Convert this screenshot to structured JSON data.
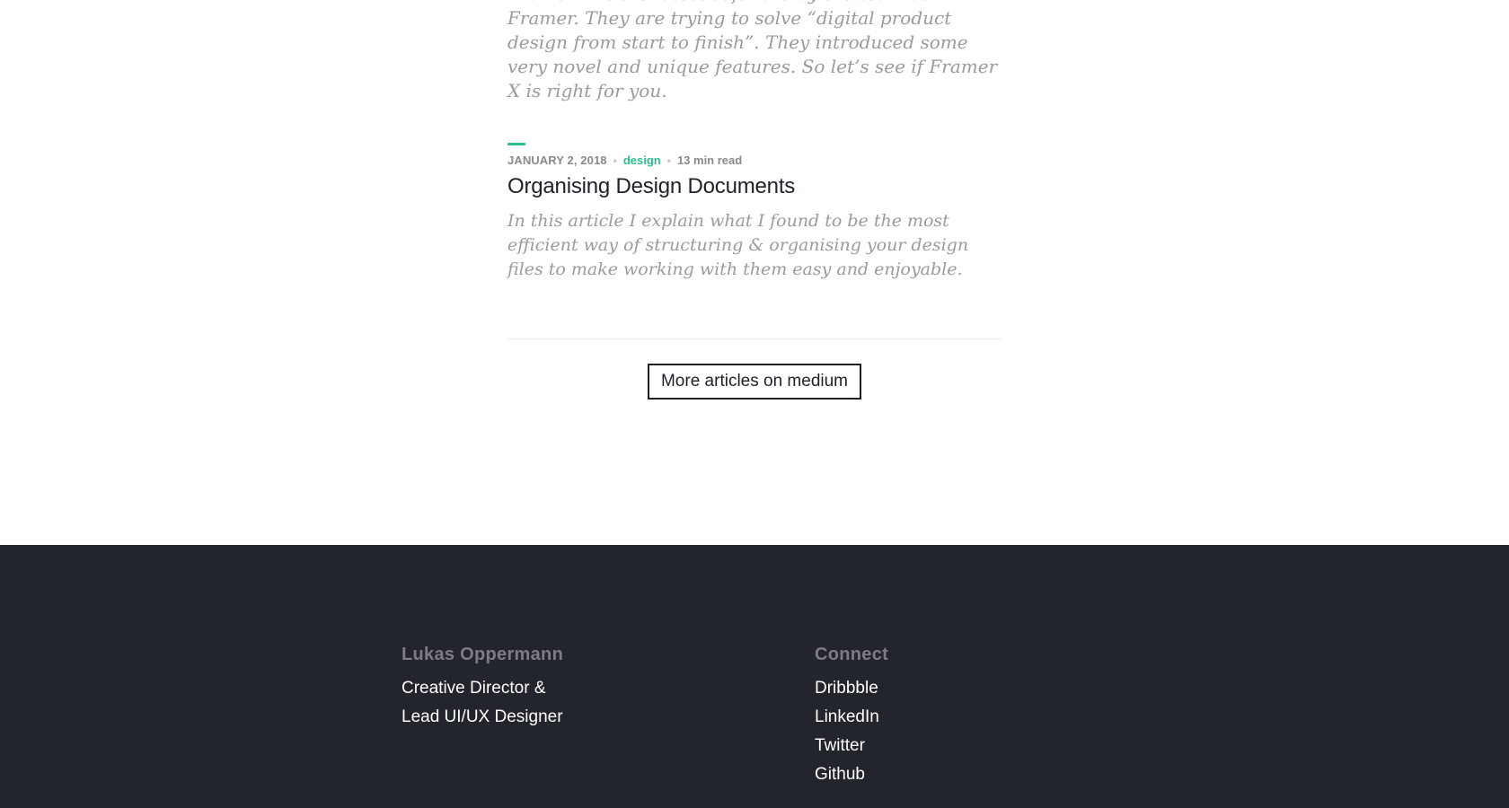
{
  "previous_article": {
    "excerpt": "Framer X is the latest software by the team at Framer. They are trying to solve “digital product design from start to finish”. They introduced some very novel and unique features. So let’s see if Framer X is right for you."
  },
  "article": {
    "date": "January 2, 2018",
    "category": "design",
    "read_time": "13 min read",
    "separator": "•",
    "title": "Organising Design Documents",
    "excerpt": "In this article I explain what I found to be the most efficient way of structuring & organising your design files to make working with them easy and enjoyable."
  },
  "more_button": {
    "label": "More articles on medium"
  },
  "footer": {
    "about": {
      "name": "Lukas Oppermann",
      "role_line1": "Creative Director &",
      "role_line2": "Lead UI/UX Designer"
    },
    "connect": {
      "heading": "Connect",
      "links": [
        "Dribbble",
        "LinkedIn",
        "Twitter",
        "Github"
      ]
    }
  },
  "colors": {
    "accent": "#2ebd8e",
    "footer_bg": "#22252b",
    "text_dark": "#1e2228",
    "text_muted": "#9b9b9b"
  }
}
